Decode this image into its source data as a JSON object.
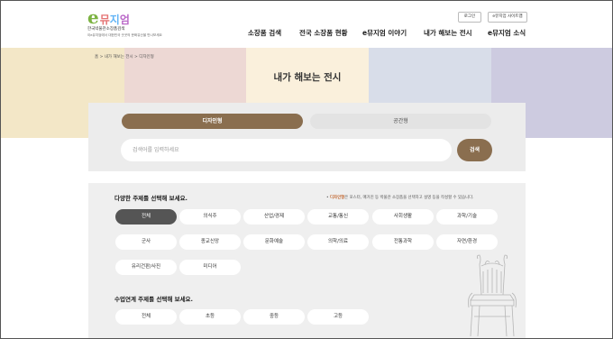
{
  "header": {
    "logo": {
      "e": "e",
      "rest": [
        "뮤",
        "지",
        "엄"
      ],
      "sub": "한국박물관소장품검색",
      "sub2": "이e뮤지엄에서 대한민국 곳곳의 문화유산을 만나보세요"
    },
    "util": {
      "login": "로그인",
      "site_map": "e뮤지엄 사이트맵"
    },
    "nav": [
      "소장품 검색",
      "전국 소장품 현황",
      "e뮤지엄 이야기",
      "내가 해보는 전시",
      "e뮤지엄 소식"
    ]
  },
  "breadcrumb": "홈 > 내가 해보는 전시 > 디자인형",
  "page_title": "내가 해보는 전시",
  "search": {
    "tabs": [
      "디자인형",
      "공간형"
    ],
    "active_tab": "디자인형",
    "placeholder": "검색어를 입력하세요",
    "button": "검색"
  },
  "topics": {
    "title": "다양한 주제를 선택해 보세요.",
    "note_bold": "디자인형",
    "note_rest": "은 포스터, 매거진 등 박물관 소장품을 선택하고 설명 등을 작성할 수 있습니다.",
    "items": [
      "전체",
      "의식주",
      "산업/경제",
      "교통/통신",
      "사회생활",
      "과학/기술",
      "군사",
      "종교신앙",
      "문화예술",
      "의학/의료",
      "전통과학",
      "자연/환경",
      "유리건판/사진",
      "미디어"
    ],
    "active": "전체"
  },
  "grades": {
    "title": "수업연계 주제를 선택해 보세요.",
    "items": [
      "전체",
      "초등",
      "중등",
      "고등"
    ]
  },
  "colors": {
    "accent": "#8a6e4f",
    "band": [
      "#f3e7c7",
      "#edd8d4",
      "#faf0dc",
      "#d8dde9",
      "#cdcbe0"
    ],
    "panel": "#ececec",
    "chip_active": "#555555"
  }
}
